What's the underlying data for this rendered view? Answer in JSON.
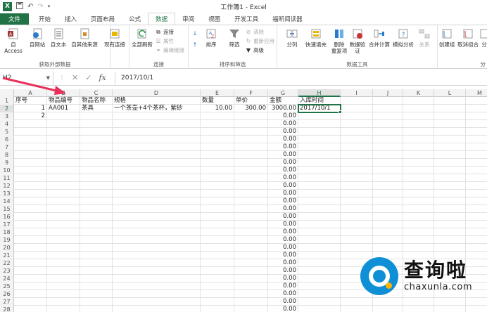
{
  "window": {
    "title": "工作簿1 - Excel",
    "quick_access": [
      "save-icon",
      "undo-icon",
      "redo-icon",
      "customize-icon"
    ]
  },
  "ribbon_tabs": [
    "文件",
    "开始",
    "插入",
    "页面布局",
    "公式",
    "数据",
    "审阅",
    "视图",
    "开发工具",
    "福昕阅读器"
  ],
  "ribbon": {
    "groups": {
      "external": "获取外部数据",
      "connections": "连接",
      "sort_filter": "排序和筛选",
      "data_tools": "数据工具",
      "outline": "分"
    },
    "buttons": {
      "access": "自 Access",
      "web": "自网站",
      "text": "自文本",
      "other": "自其他来源",
      "existing": "现有连接",
      "refresh_all": "全部刷新",
      "connections": "连接",
      "properties": "属性",
      "edit_links": "编辑链接",
      "sort_az": "A↓Z",
      "sort": "排序",
      "filter": "筛选",
      "clear": "清除",
      "reapply": "重新应用",
      "advanced": "高级",
      "split": "分列",
      "flash_fill": "快速填充",
      "remove_dup": "删除\n重复项",
      "validation": "数据验\n证",
      "consolidate": "合并计算",
      "whatif": "模拟分析",
      "relations": "关系",
      "group": "创建组",
      "ungroup": "取消组合",
      "subtotal": "分"
    }
  },
  "formula_bar": {
    "name_box": "H2",
    "value": "2017/10/1",
    "fx": "fx"
  },
  "columns": [
    "A",
    "B",
    "C",
    "D",
    "E",
    "F",
    "G",
    "H",
    "I",
    "J",
    "K",
    "L",
    "M"
  ],
  "rows": [
    {
      "n": "1",
      "A": "序号",
      "B": "物品编号",
      "C": "物品名称",
      "D": "规格",
      "E": "数量",
      "F": "单价",
      "G": "金额",
      "H": "入库时间"
    },
    {
      "n": "2",
      "A": "1",
      "B": "AA001",
      "C": "茶具",
      "D": "一个茶壶+4个茶杯，紫砂",
      "E": "10.00",
      "F": "300.00",
      "G": "3000.00",
      "H": "2017/10/1"
    },
    {
      "n": "3",
      "A": "2",
      "G": "0.00"
    },
    {
      "n": "4",
      "G": "0.00"
    },
    {
      "n": "5",
      "G": "0.00"
    },
    {
      "n": "6",
      "G": "0.00"
    },
    {
      "n": "7",
      "G": "0.00"
    },
    {
      "n": "8",
      "G": "0.00"
    },
    {
      "n": "9",
      "G": "0.00"
    },
    {
      "n": "10",
      "G": "0.00"
    },
    {
      "n": "11",
      "G": "0.00"
    },
    {
      "n": "12",
      "G": "0.00"
    },
    {
      "n": "13",
      "G": "0.00"
    },
    {
      "n": "14",
      "G": "0.00"
    },
    {
      "n": "15",
      "G": "0.00"
    },
    {
      "n": "16",
      "G": "0.00"
    },
    {
      "n": "17",
      "G": "0.00"
    },
    {
      "n": "18",
      "G": "0.00"
    },
    {
      "n": "19",
      "G": "0.00"
    },
    {
      "n": "20",
      "G": "0.00"
    },
    {
      "n": "21",
      "G": "0.00"
    },
    {
      "n": "22",
      "G": "0.00"
    },
    {
      "n": "23",
      "G": "0.00"
    },
    {
      "n": "24",
      "G": "0.00"
    },
    {
      "n": "25",
      "G": "0.00"
    },
    {
      "n": "26",
      "G": "0.00"
    },
    {
      "n": "27",
      "G": "0.00"
    },
    {
      "n": "28",
      "G": "0.00"
    }
  ],
  "selected": {
    "col": "H",
    "row": "2"
  },
  "watermark": {
    "cn": "查询啦",
    "en": "chaxunla.com"
  },
  "colors": {
    "accent": "#217346",
    "arrow": "#e8305a",
    "watermark_blue": "#0e8fd6",
    "watermark_dot": "#ffb400"
  }
}
